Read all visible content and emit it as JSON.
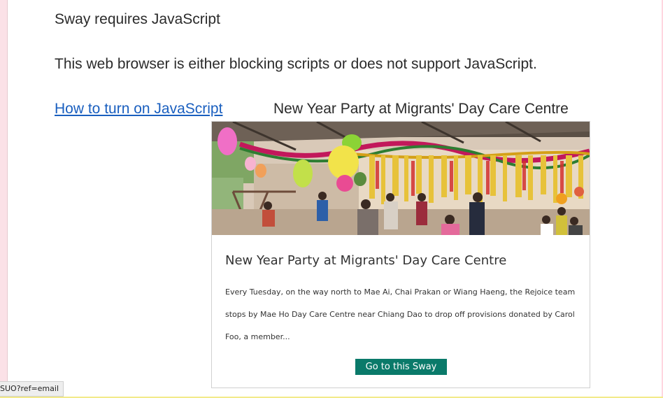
{
  "noscript": {
    "title": "Sway requires JavaScript",
    "message": "This web browser is either blocking scripts or does not support JavaScript.",
    "link_label": "How to turn on JavaScript"
  },
  "sway": {
    "heading": "New Year Party at Migrants' Day Care Centre",
    "card": {
      "title": "New Year Party at Migrants' Day Care Centre",
      "description": "Every Tuesday, on the way north to Mae Ai, Chai Prakan or Wiang Haeng, the Rejoice team stops by Mae Ho Day Care Centre near Chiang Dao to drop off provisions donated by Carol Foo, a member...",
      "button_label": "Go to this Sway",
      "button_color": "#0a7a6a"
    }
  },
  "status_bar": {
    "url_fragment": "SUO?ref=email"
  },
  "colors": {
    "link": "#1a5fbf",
    "text": "#2b2b2b",
    "frame": "#ffd6e0"
  }
}
